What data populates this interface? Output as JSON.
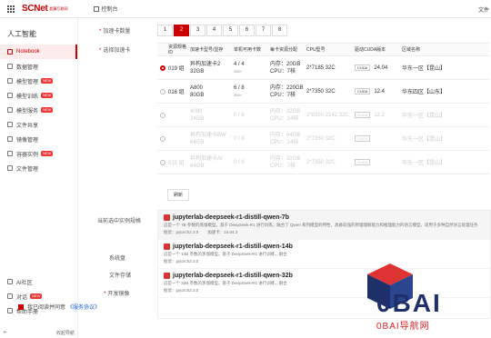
{
  "topbar": {
    "logo": "SCNet",
    "logo_sub": "超算互联网",
    "nav_label": "控制台",
    "right_text": "文件"
  },
  "sidebar": {
    "title": "人工智能",
    "items": [
      {
        "label": "Notebook",
        "icon": "notebook-icon",
        "active": true,
        "badge": ""
      },
      {
        "label": "数据管理",
        "icon": "data-icon",
        "active": false,
        "badge": ""
      },
      {
        "label": "模型管理",
        "icon": "model-icon",
        "active": false,
        "badge": "NEW"
      },
      {
        "label": "模型训练",
        "icon": "train-icon",
        "active": false,
        "badge": "NEW"
      },
      {
        "label": "模型服务",
        "icon": "service-icon",
        "active": false,
        "badge": "NEW"
      },
      {
        "label": "文件共享",
        "icon": "share-icon",
        "active": false,
        "badge": ""
      },
      {
        "label": "镜像管理",
        "icon": "image-icon",
        "active": false,
        "badge": ""
      },
      {
        "label": "容器实例",
        "icon": "container-icon",
        "active": false,
        "badge": "NEW"
      },
      {
        "label": "文件管理",
        "icon": "file-icon",
        "active": false,
        "badge": ""
      }
    ],
    "bottom_items": [
      {
        "label": "AI社区",
        "icon": "community-icon"
      },
      {
        "label": "对话",
        "icon": "chat-icon",
        "badge": "NEW"
      },
      {
        "label": "帮助手册",
        "icon": "help-icon"
      }
    ],
    "collapse_label": "收起导航"
  },
  "form": {
    "accel_count_label": "加速卡数量",
    "select_card_label": "选择加速卡",
    "pages": [
      "1",
      "2",
      "3",
      "4",
      "5",
      "6",
      "7",
      "8"
    ],
    "active_page": "2",
    "table_headers": [
      "资源规格ID",
      "加速卡型号/显存",
      "单机可用卡数",
      "每卡资源分配",
      "CPU型号",
      "驱动CUDA版本",
      "区域名称"
    ],
    "rows": [
      {
        "id": "019 组",
        "card": "异构加速卡2",
        "mem": "32GB",
        "avail": "4 / 4",
        "avail_sub": "200+",
        "alloc1": "内存：20GB",
        "alloc2": "CPU：7核",
        "cpu": "2*7185 32C",
        "cuda": "24.04",
        "region": "华东一区【昆山】",
        "selected": true,
        "disabled": false
      },
      {
        "id": "016 组",
        "card": "A800",
        "mem": "80GB",
        "avail": "6 / 8",
        "avail_sub": "200+",
        "alloc1": "内存：220GB",
        "alloc2": "CPU：7核",
        "cpu": "2*7350 32C",
        "cuda": "12.4",
        "region": "华东四区【山东】",
        "selected": false,
        "disabled": false
      },
      {
        "id": "",
        "card": "4090",
        "mem": "24GB",
        "avail": "0 / 8",
        "avail_sub": "",
        "alloc1": "内存：32GB",
        "alloc2": "CPU：14核",
        "cpu": "2*8350 2142.32C",
        "cuda": "12.2",
        "region": "华东一区【昆山】",
        "selected": false,
        "disabled": true
      },
      {
        "id": "",
        "card": "异构加速卡BW",
        "mem": "64GB",
        "avail": "0 / 8",
        "avail_sub": "",
        "alloc1": "内存：64GB",
        "alloc2": "CPU：14核",
        "cpu": "2*7350 32C",
        "cuda": "",
        "region": "华东一区【昆山】",
        "selected": false,
        "disabled": true
      },
      {
        "id": "015 组",
        "card": "异构加速卡AI",
        "mem": "64GB",
        "avail": "0 / 8",
        "avail_sub": "",
        "alloc1": "内存：32GB",
        "alloc2": "CPU：7核",
        "cpu": "2*7350 32C",
        "cuda": "",
        "region": "华东一区【昆山】",
        "selected": false,
        "disabled": true
      }
    ],
    "refresh_label": "刷新",
    "image_label": "当前选中实例规格",
    "system_disk_label": "系统盘",
    "file_storage_label": "文件存储",
    "dev_image_label": "开发镜像",
    "images": [
      {
        "title": "jupyterlab-deepseek-r1-distill-qwen-7b",
        "desc": "这是一个 7B 参数的蒸馏模型。基于 DeepSeek-R1 进行训练，融合了 Qwen 系列模型的特性，具备较强的原理理解能力和推理能力的语言模型，适用于多种自然语言处理任务",
        "meta1": "框架：pytorch2.3.0",
        "meta2": "加速卡：24.04.3",
        "selected": true
      },
      {
        "title": "jupyterlab-deepseek-r1-distill-qwen-14b",
        "desc": "这是一个 14B 参数的蒸馏模型。基于 DeepSeek-R1 进行训练，融合",
        "meta1": "框架：pytorch2.3.0",
        "meta2": "",
        "selected": false
      },
      {
        "title": "jupyterlab-deepseek-r1-distill-qwen-32b",
        "desc": "这是一个 32B 参数的蒸馏模型。基于 DeepSeek-R1 进行训练，融合",
        "meta1": "框架：pytorch2.3.0",
        "meta2": "",
        "selected": false
      }
    ],
    "agree_text": "我已阅读并同意",
    "agree_link": "《服务协议》"
  },
  "watermark": {
    "text": "0BAI",
    "sub": "0BAI导航网"
  }
}
